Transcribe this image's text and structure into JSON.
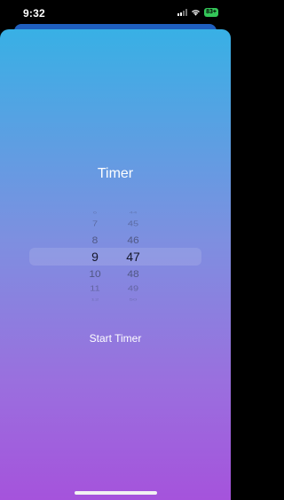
{
  "status_bar": {
    "time": "9:32",
    "battery": "83+"
  },
  "timer": {
    "title": "Timer",
    "start_label": "Start Timer",
    "picker": {
      "hours": [
        "6",
        "7",
        "8",
        "9",
        "10",
        "11",
        "12"
      ],
      "minutes": [
        "44",
        "45",
        "46",
        "47",
        "48",
        "49",
        "50"
      ],
      "selected_hour": "9",
      "selected_minute": "47"
    }
  },
  "colors": {
    "gradient_top": "#38b0e5",
    "gradient_bottom": "#a553dc",
    "battery": "#34c759"
  }
}
